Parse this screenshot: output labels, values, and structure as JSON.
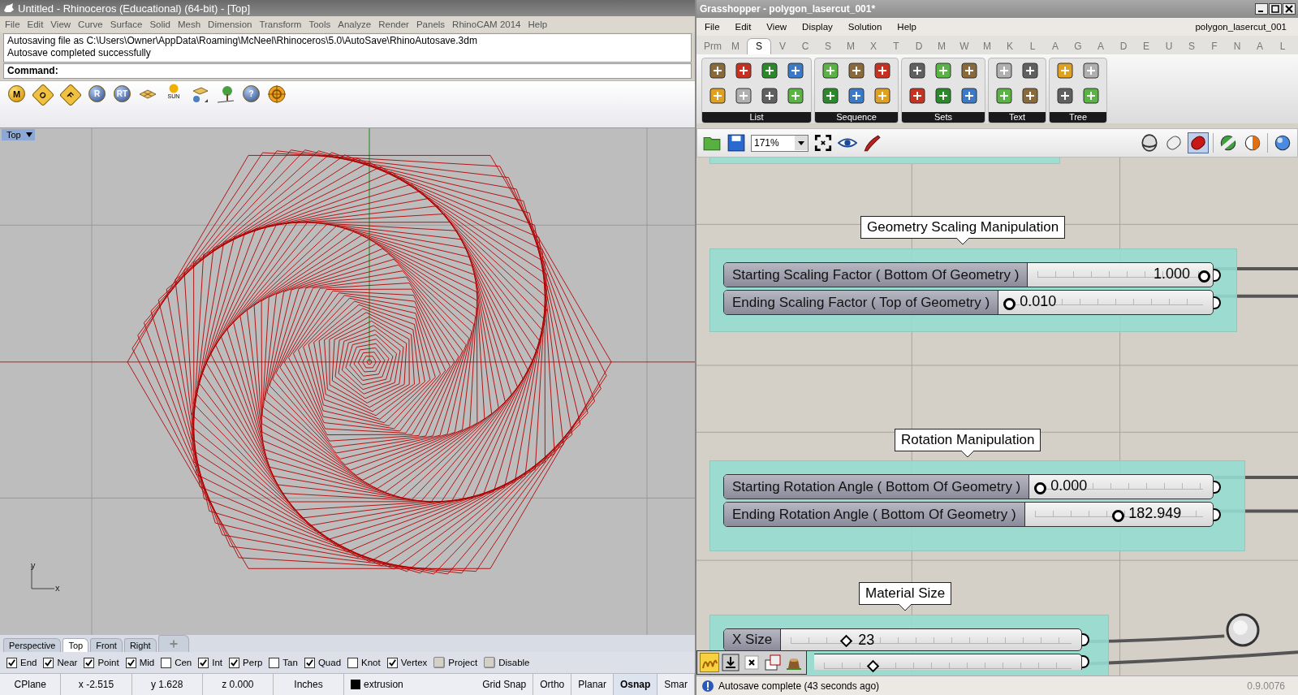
{
  "rhino": {
    "title": "Untitled - Rhinoceros (Educational) (64-bit) - [Top]",
    "menu": [
      "File",
      "Edit",
      "View",
      "Curve",
      "Surface",
      "Solid",
      "Mesh",
      "Dimension",
      "Transform",
      "Tools",
      "Analyze",
      "Render",
      "Panels",
      "RhinoCAM 2014",
      "Help"
    ],
    "command_history": [
      "Autosaving file as C:\\Users\\Owner\\AppData\\Roaming\\McNeel\\Rhinoceros\\5.0\\AutoSave\\RhinoAutosave.3dm",
      "Autosave completed successfully"
    ],
    "command_prompt": "Command:",
    "toolbar": [
      {
        "kind": "ball",
        "label": "M"
      },
      {
        "kind": "tag",
        "label": "O"
      },
      {
        "kind": "tag",
        "label": "F"
      },
      {
        "kind": "ball",
        "label": "R"
      },
      {
        "kind": "ball",
        "label": "RT"
      },
      {
        "kind": "plane"
      },
      {
        "kind": "sun",
        "label": "SUN"
      },
      {
        "kind": "layer"
      },
      {
        "kind": "tree"
      },
      {
        "kind": "ball",
        "label": "?"
      },
      {
        "kind": "target"
      }
    ],
    "viewport": {
      "label": "Top",
      "axis_x": "x",
      "axis_y": "y"
    },
    "viewport_tabs": [
      {
        "label": "Perspective",
        "selected": false
      },
      {
        "label": "Top",
        "selected": true
      },
      {
        "label": "Front",
        "selected": false
      },
      {
        "label": "Right",
        "selected": false
      }
    ],
    "osnaps": [
      {
        "kind": "check",
        "label": "End",
        "checked": true
      },
      {
        "kind": "check",
        "label": "Near",
        "checked": true
      },
      {
        "kind": "check",
        "label": "Point",
        "checked": true
      },
      {
        "kind": "check",
        "label": "Mid",
        "checked": true
      },
      {
        "kind": "check",
        "label": "Cen",
        "checked": false
      },
      {
        "kind": "check",
        "label": "Int",
        "checked": true
      },
      {
        "kind": "check",
        "label": "Perp",
        "checked": true
      },
      {
        "kind": "check",
        "label": "Tan",
        "checked": false
      },
      {
        "kind": "check",
        "label": "Quad",
        "checked": true
      },
      {
        "kind": "check",
        "label": "Knot",
        "checked": false
      },
      {
        "kind": "check",
        "label": "Vertex",
        "checked": true
      },
      {
        "kind": "toggle",
        "label": "Project",
        "checked": false
      },
      {
        "kind": "toggle",
        "label": "Disable",
        "checked": false
      }
    ],
    "status_bar": [
      {
        "kind": "text",
        "label": "CPlane"
      },
      {
        "kind": "text",
        "label": "x -2.515"
      },
      {
        "kind": "text",
        "label": "y 1.628"
      },
      {
        "kind": "text",
        "label": "z 0.000"
      },
      {
        "kind": "text",
        "label": "Inches"
      },
      {
        "kind": "layer",
        "label": "extrusion",
        "color": "#000000"
      },
      {
        "kind": "toggle",
        "label": "Grid Snap",
        "on": false
      },
      {
        "kind": "toggle",
        "label": "Ortho",
        "on": false
      },
      {
        "kind": "toggle",
        "label": "Planar",
        "on": false
      },
      {
        "kind": "toggle",
        "label": "Osnap",
        "on": true
      },
      {
        "kind": "toggle",
        "label": "Smar",
        "on": false
      }
    ]
  },
  "grasshopper": {
    "title": "Grasshopper - polygon_lasercut_001*",
    "menu": [
      "File",
      "Edit",
      "View",
      "Display",
      "Solution",
      "Help"
    ],
    "document": "polygon_lasercut_001",
    "tabs": [
      {
        "label": "Prm",
        "selected": false
      },
      {
        "label": "M",
        "selected": false
      },
      {
        "label": "S",
        "selected": true
      },
      {
        "label": "V",
        "selected": false
      },
      {
        "label": "C",
        "selected": false
      },
      {
        "label": "S",
        "selected": false
      },
      {
        "label": "M",
        "selected": false
      },
      {
        "label": "X",
        "selected": false
      },
      {
        "label": "T",
        "selected": false
      },
      {
        "label": "D",
        "selected": false
      },
      {
        "label": "M",
        "selected": false
      },
      {
        "label": "W",
        "selected": false
      },
      {
        "label": "M",
        "selected": false
      },
      {
        "label": "K",
        "selected": false
      },
      {
        "label": "L",
        "selected": false
      },
      {
        "label": "A",
        "selected": false
      },
      {
        "label": "G",
        "selected": false
      },
      {
        "label": "A",
        "selected": false
      },
      {
        "label": "D",
        "selected": false
      },
      {
        "label": "E",
        "selected": false
      },
      {
        "label": "U",
        "selected": false
      },
      {
        "label": "S",
        "selected": false
      },
      {
        "label": "F",
        "selected": false
      },
      {
        "label": "N",
        "selected": false
      },
      {
        "label": "A",
        "selected": false
      },
      {
        "label": "L",
        "selected": false
      }
    ],
    "panels": [
      "List",
      "Sequence",
      "Sets",
      "Text",
      "Tree"
    ],
    "zoom": "171%",
    "groups": [
      {
        "title": "Geometry Scaling Manipulation",
        "sliders": [
          {
            "kind": "float",
            "label": "Starting Scaling Factor ( Bottom Of Geometry )",
            "value": "1.000",
            "level": 1
          },
          {
            "kind": "float",
            "label": "Ending Scaling Factor ( Top of Geometry )",
            "value": "0.010",
            "level": 0
          }
        ]
      },
      {
        "title": "Rotation Manipulation",
        "sliders": [
          {
            "kind": "float",
            "label": "Starting Rotation Angle ( Bottom Of Geometry )",
            "value": "0.000",
            "level": 0
          },
          {
            "kind": "float",
            "label": "Ending Rotation Angle ( Bottom Of Geometry )",
            "value": "182.949",
            "level": 0.49
          }
        ]
      },
      {
        "title": "Material Size",
        "sliders": [
          {
            "kind": "integer",
            "label": "X Size",
            "value": "23",
            "level": 0.2
          },
          {
            "kind": "integer",
            "level": 0.2
          }
        ]
      }
    ],
    "status": "Autosave complete (43 seconds ago)",
    "version": "0.9.0076"
  }
}
